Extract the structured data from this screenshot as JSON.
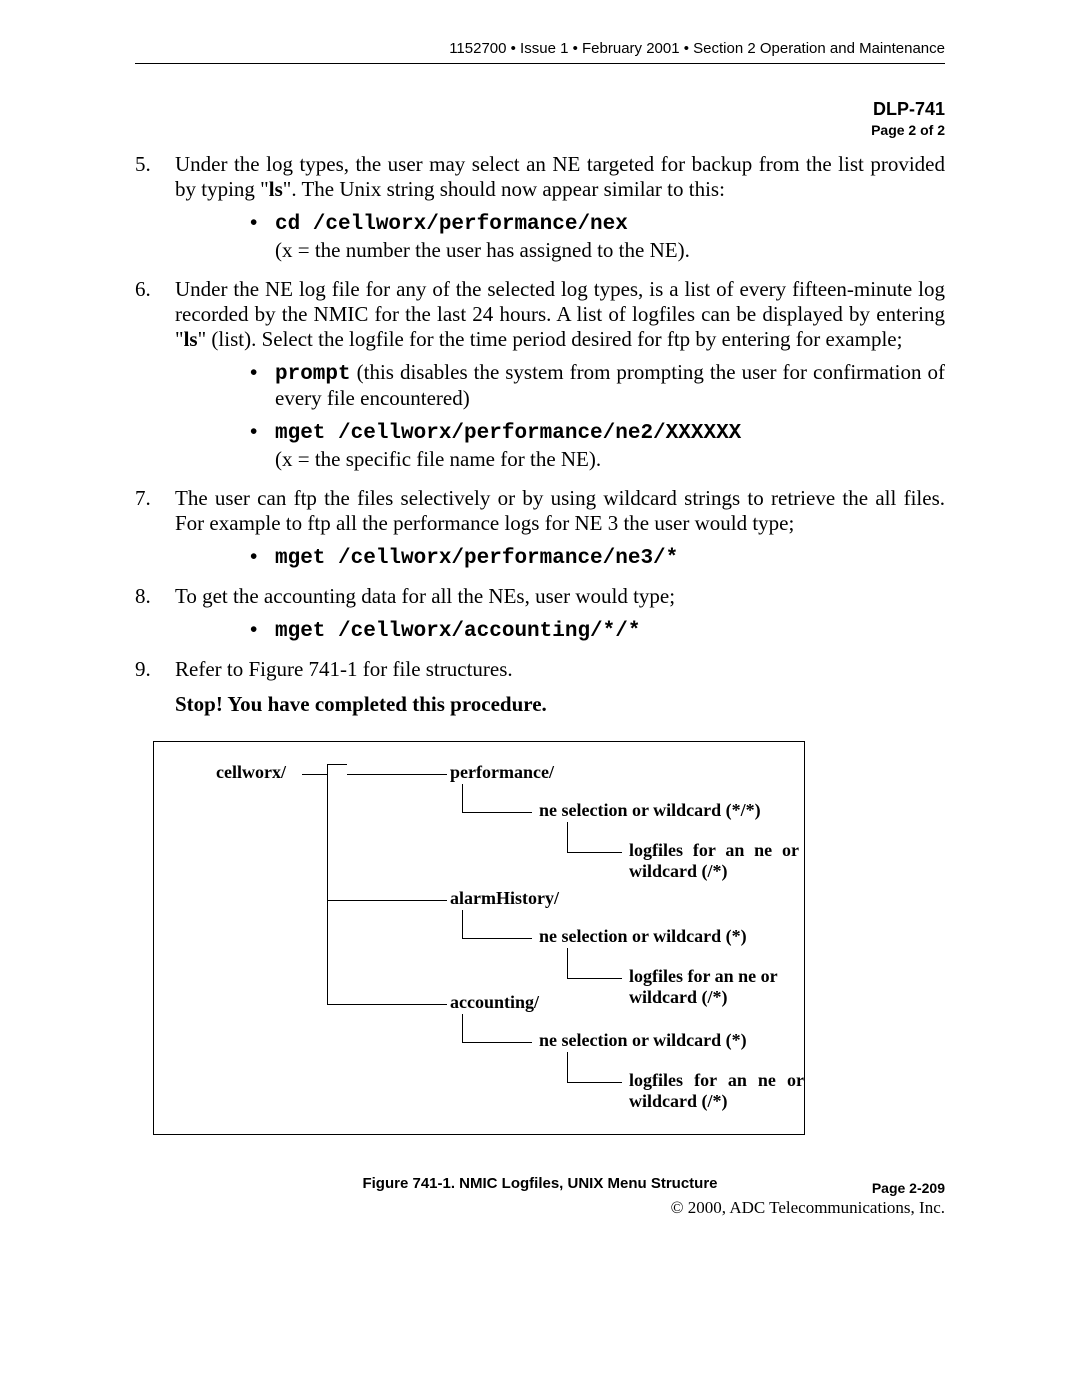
{
  "header": {
    "line": "1152700 • Issue 1 • February 2001 • Section 2 Operation and Maintenance"
  },
  "dlp": {
    "title": "DLP-741",
    "page": "Page 2 of 2"
  },
  "items": {
    "n5": "5.",
    "t5a": "Under the log types, the user may select an NE targeted for backup from the list provided by typing \"",
    "t5b": "ls",
    "t5c": "\". The Unix string should now appear similar to this:",
    "b5cmd": "cd /cellworx/performance/nex",
    "b5note": "(x = the number the user has assigned to the NE).",
    "n6": "6.",
    "t6a": "Under the NE log file for any of the selected log types, is a list of every fifteen-minute log recorded by the NMIC for the last 24 hours. A list of logfiles can be displayed by entering \"",
    "t6b": "ls",
    "t6c": "\" (list). Select the logfile for the time period desired for ftp by entering for example;",
    "b6a_cmd": "prompt",
    "b6a_txt": "  (this disables the system from prompting the user for confirmation of every file encountered)",
    "b6b_cmd": "mget /cellworx/performance/ne2/XXXXXX",
    "b6b_note": "(x = the specific file name for the NE).",
    "n7": "7.",
    "t7": "The user can ftp the files selectively or by using wildcard strings to retrieve the all files. For example to ftp all the performance logs for NE 3 the user would type;",
    "b7cmd": "mget /cellworx/performance/ne3/*",
    "n8": "8.",
    "t8": "To get the accounting data for all the NEs, user would type;",
    "b8cmd": "mget /cellworx/accounting/*/*",
    "n9": "9.",
    "t9": "Refer to Figure 741-1 for file structures.",
    "stop": "Stop! You have completed this procedure."
  },
  "diagram": {
    "cellworx": "cellworx/",
    "performance": "performance/",
    "alarmHistory": "alarmHistory/",
    "accounting": "accounting/",
    "ne_sel_star_star": "ne selection or wildcard (*/*)",
    "ne_sel_star": "ne selection or wildcard (*)",
    "log_ne_or_wild": "logfiles for an ne or wildcard (/*)",
    "log_ne_or_wild_break": "logfiles  for  an  ne or wildcard (/*)",
    "log_ne_or_wild_break2": "logfiles  for  an  ne  or wildcard (/*)"
  },
  "caption": "Figure 741-1.  NMIC Logfiles,  UNIX Menu Structure",
  "footer": {
    "page": "Page 2-209",
    "copy": "© 2000, ADC Telecommunications, Inc."
  }
}
